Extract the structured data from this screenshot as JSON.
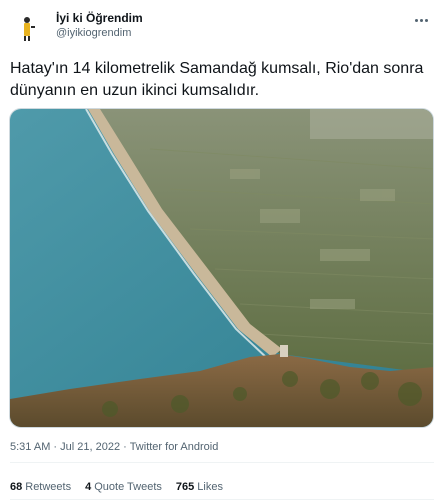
{
  "author": {
    "display_name": "İyi ki Öğrendim",
    "handle": "@iyikiogrendim"
  },
  "tweet": {
    "text": "Hatay'ın 14 kilometrelik Samandağ kumsalı, Rio'dan sonra dünyanın en uzun ikinci kumsalıdır."
  },
  "meta": {
    "time": "5:31 AM",
    "separator1": "·",
    "date": "Jul 21, 2022",
    "separator2": "·",
    "source": "Twitter for Android"
  },
  "stats": {
    "retweets_count": "68",
    "retweets_label": "Retweets",
    "quotes_count": "4",
    "quotes_label": "Quote Tweets",
    "likes_count": "765",
    "likes_label": "Likes"
  },
  "icons": {
    "more": "more-horizontal-icon"
  },
  "colors": {
    "text_primary": "#0f1419",
    "text_secondary": "#536471",
    "border": "#cfd9de",
    "sea": "#3f8fa0",
    "land": "#6f7d55",
    "beach": "#c9b89a"
  }
}
